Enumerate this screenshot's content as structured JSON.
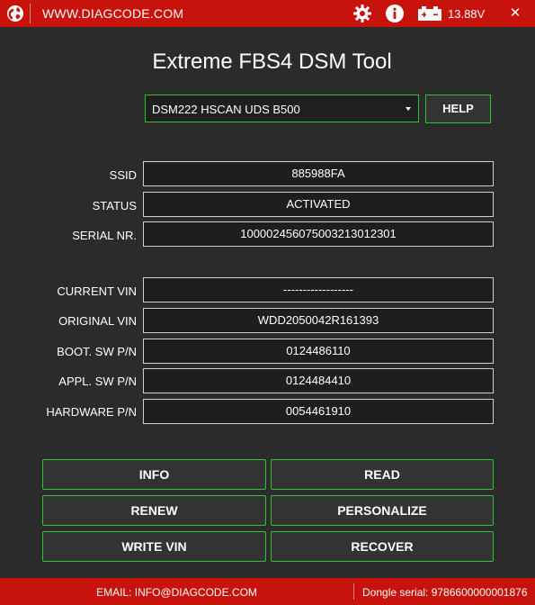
{
  "titlebar": {
    "url": "WWW.DIAGCODE.COM",
    "voltage": "13.88V",
    "close_glyph": "✕",
    "icons": {
      "globe": "globe-icon",
      "settings": "gear-icon",
      "info": "info-icon",
      "battery": "battery-icon"
    }
  },
  "app_title": "Extreme FBS4 DSM Tool",
  "device_select": {
    "value": "DSM222 HSCAN UDS B500"
  },
  "help_label": "HELP",
  "fields": [
    {
      "label": "SSID",
      "value": "885988FA"
    },
    {
      "label": "STATUS",
      "value": "ACTIVATED"
    },
    {
      "label": "SERIAL NR.",
      "value": "1000024560750032130123​01"
    },
    {
      "label": "CURRENT VIN",
      "value": "------------------"
    },
    {
      "label": "ORIGINAL VIN",
      "value": "WDD2050042R161393"
    },
    {
      "label": "BOOT. SW P/N",
      "value": "0124486110"
    },
    {
      "label": "APPL. SW P/N",
      "value": "0124484410"
    },
    {
      "label": "HARDWARE P/N",
      "value": "0054461910"
    }
  ],
  "buttons": {
    "info": "INFO",
    "read": "READ",
    "renew": "RENEW",
    "personalize": "PERSONALIZE",
    "write_vin": "WRITE VIN",
    "recover": "RECOVER"
  },
  "footer": {
    "email": "EMAIL: INFO@DIAGCODE.COM",
    "dongle_serial": "Dongle serial: 9786600000001876"
  },
  "colors": {
    "brand_red": "#c8120c",
    "accent_green": "#2ec22e",
    "background": "#2b2b2b"
  }
}
